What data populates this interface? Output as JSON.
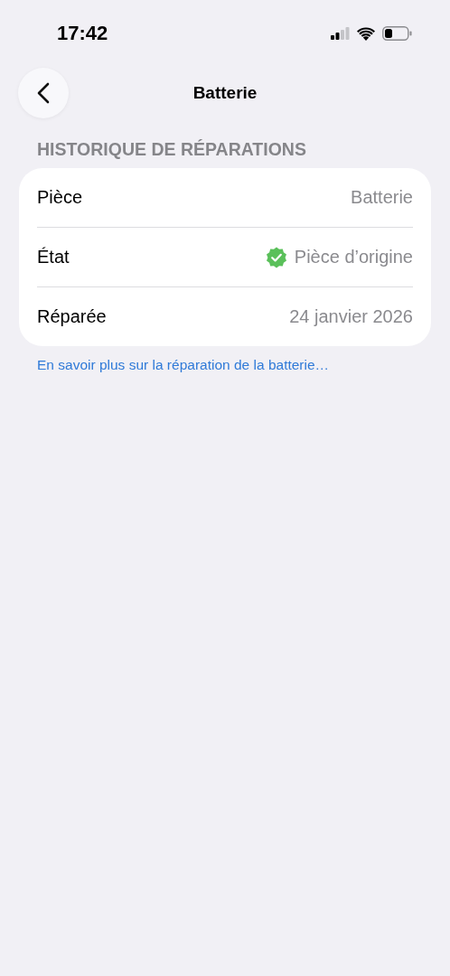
{
  "status_bar": {
    "time": "17:42"
  },
  "nav": {
    "title": "Batterie"
  },
  "section": {
    "header": "HISTORIQUE DE RÉPARATIONS",
    "rows": [
      {
        "label": "Pièce",
        "value": "Batterie",
        "verified": false
      },
      {
        "label": "État",
        "value": "Pièce d’origine",
        "verified": true
      },
      {
        "label": "Réparée",
        "value": "24 janvier 2026",
        "verified": false
      }
    ],
    "footer_link": "En savoir plus sur la réparation de la batterie…"
  }
}
